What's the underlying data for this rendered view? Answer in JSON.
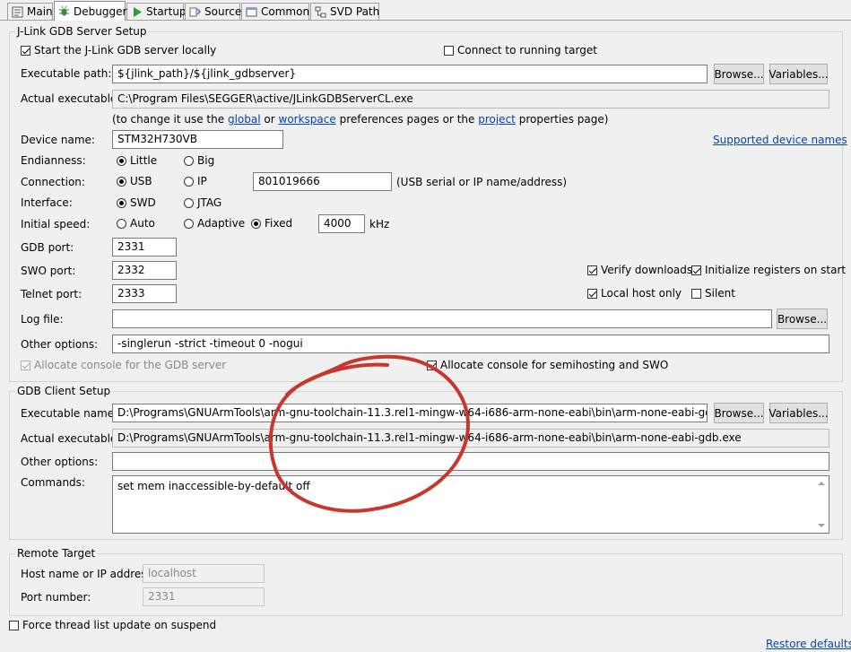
{
  "tabs": [
    {
      "label": "Main",
      "icon": "main-icon"
    },
    {
      "label": "Debugger",
      "icon": "debug-bug-icon"
    },
    {
      "label": "Startup",
      "icon": "play-icon"
    },
    {
      "label": "Source",
      "icon": "source-icon"
    },
    {
      "label": "Common",
      "icon": "common-icon"
    },
    {
      "label": "SVD Path",
      "icon": "svd-icon"
    }
  ],
  "server": {
    "group_title": "J-Link GDB Server Setup",
    "start_locally": "Start the J-Link GDB server locally",
    "connect_running": "Connect to running target",
    "exe_label": "Executable path:",
    "exe_value": "${jlink_path}/${jlink_gdbserver}",
    "browse": "Browse...",
    "variables": "Variables...",
    "actual_label": "Actual executable:",
    "actual_value": "C:\\Program Files\\SEGGER\\active/JLinkGDBServerCL.exe",
    "hint_pre": "(to change it use the",
    "hint_global": "global",
    "hint_or": "or",
    "hint_workspace": "workspace",
    "hint_mid": "preferences pages or the",
    "hint_project": "project",
    "hint_post": "properties page)",
    "device_label": "Device name:",
    "device_value": "STM32H730VB",
    "supported_link": "Supported device names",
    "endian_label": "Endianness:",
    "endian_little": "Little",
    "endian_big": "Big",
    "conn_label": "Connection:",
    "conn_usb": "USB",
    "conn_ip": "IP",
    "conn_value": "801019666",
    "conn_hint": "(USB serial or IP name/address)",
    "iface_label": "Interface:",
    "iface_swd": "SWD",
    "iface_jtag": "JTAG",
    "speed_label": "Initial speed:",
    "speed_auto": "Auto",
    "speed_adaptive": "Adaptive",
    "speed_fixed": "Fixed",
    "speed_value": "4000",
    "speed_unit": "kHz",
    "gdbport_label": "GDB port:",
    "gdbport_value": "2331",
    "swoport_label": "SWO port:",
    "swoport_value": "2332",
    "telnet_label": "Telnet port:",
    "telnet_value": "2333",
    "verify": "Verify downloads",
    "init_regs": "Initialize registers on start",
    "localhost": "Local host only",
    "silent": "Silent",
    "log_label": "Log file:",
    "log_value": "",
    "other_label": "Other options:",
    "other_value": "-singlerun -strict -timeout 0 -nogui",
    "alloc_gdb": "Allocate console for the GDB server",
    "alloc_semi": "Allocate console for semihosting and SWO"
  },
  "client": {
    "group_title": "GDB Client Setup",
    "exe_label": "Executable name:",
    "exe_value": "D:\\Programs\\GNUArmTools\\arm-gnu-toolchain-11.3.rel1-mingw-w64-i686-arm-none-eabi\\bin\\arm-none-eabi-gdb.exe",
    "browse": "Browse...",
    "variables": "Variables...",
    "actual_label": "Actual executable:",
    "actual_value": "D:\\Programs\\GNUArmTools\\arm-gnu-toolchain-11.3.rel1-mingw-w64-i686-arm-none-eabi\\bin\\arm-none-eabi-gdb.exe",
    "other_label": "Other options:",
    "other_value": "",
    "commands_label": "Commands:",
    "commands_value": "set mem inaccessible-by-default off"
  },
  "remote": {
    "group_title": "Remote Target",
    "host_label": "Host name or IP address:",
    "host_value": "localhost",
    "port_label": "Port number:",
    "port_value": "2331"
  },
  "force_thread": "Force thread list update on suspend",
  "restore_defaults": "Restore defaults",
  "colors": {
    "annotation": "#c8372d",
    "link": "#0645ad"
  }
}
